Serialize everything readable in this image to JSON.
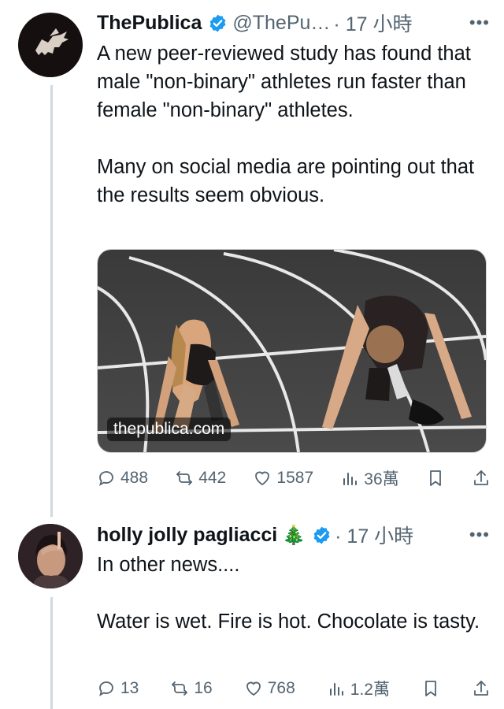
{
  "tweets": [
    {
      "name": "ThePublica",
      "handle": "@ThePu…",
      "time": "· 17 小時",
      "text": "A new peer-reviewed study has found that male \"non-binary\" athletes run faster than female \"non-binary\" athletes.\n\nMany on social media are pointing out that the results seem obvious.",
      "media_caption": "thepublica.com",
      "replies": "488",
      "reposts": "442",
      "likes": "1587",
      "views": "36萬"
    },
    {
      "name": "holly jolly pagliacci",
      "emoji": "🎄",
      "time": "· 17 小時",
      "text": "In other news....\n\nWater is wet. Fire is hot. Chocolate is tasty.",
      "replies": "13",
      "reposts": "16",
      "likes": "768",
      "views": "1.2萬"
    }
  ],
  "colors": {
    "verified": "#1d9bf0",
    "muted": "#536471",
    "thread_line": "#cfd9de"
  },
  "icons": [
    "more-icon",
    "reply-icon",
    "repost-icon",
    "like-icon",
    "views-icon",
    "bookmark-icon",
    "share-icon",
    "verified-badge-icon"
  ]
}
